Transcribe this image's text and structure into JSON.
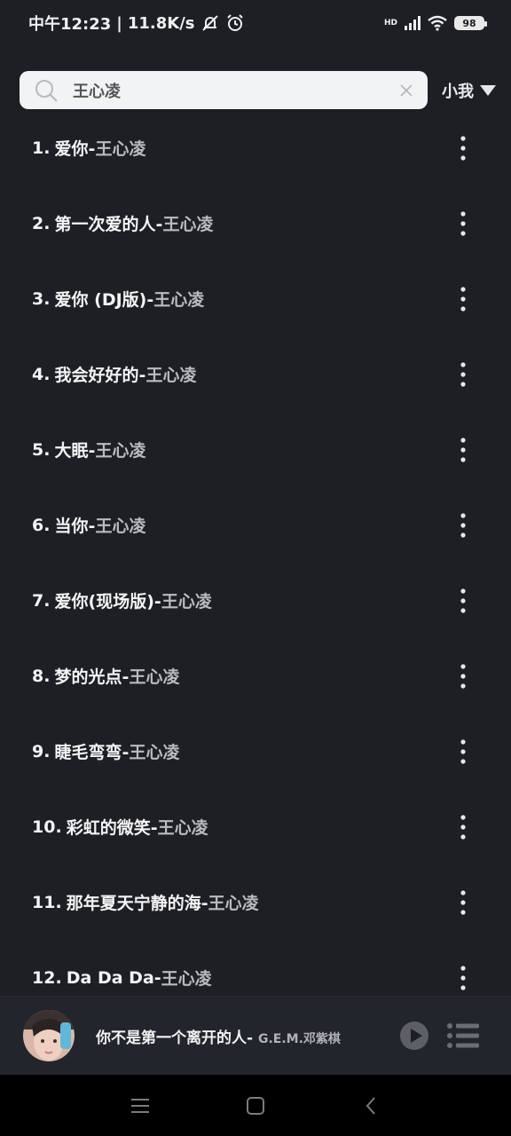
{
  "status": {
    "time": "中午12:23",
    "net_speed": "11.8K/s",
    "battery": "98",
    "hd_label": "HD"
  },
  "search": {
    "query": "王心凌",
    "user": "小我"
  },
  "songs": [
    {
      "num": "1.",
      "title": "爱你-",
      "artist": "王心凌"
    },
    {
      "num": "2.",
      "title": "第一次爱的人-",
      "artist": "王心凌"
    },
    {
      "num": "3.",
      "title": "爱你 (DJ版)-",
      "artist": "王心凌"
    },
    {
      "num": "4.",
      "title": "我会好好的-",
      "artist": "王心凌"
    },
    {
      "num": "5.",
      "title": "大眠-",
      "artist": "王心凌"
    },
    {
      "num": "6.",
      "title": "当你-",
      "artist": "王心凌"
    },
    {
      "num": "7.",
      "title": "爱你(现场版)-",
      "artist": "王心凌"
    },
    {
      "num": "8.",
      "title": "梦的光点-",
      "artist": "王心凌"
    },
    {
      "num": "9.",
      "title": "睫毛弯弯-",
      "artist": "王心凌"
    },
    {
      "num": "10.",
      "title": "彩虹的微笑-",
      "artist": "王心凌"
    },
    {
      "num": "11.",
      "title": "那年夏天宁静的海-",
      "artist": "王心凌"
    },
    {
      "num": "12.",
      "title": "Da Da Da-",
      "artist": "王心凌"
    }
  ],
  "player": {
    "title": "你不是第一个离开的人- ",
    "artist": "G.E.M.邓紫棋"
  },
  "icons": {
    "search": "search-icon",
    "clear": "close-icon",
    "dropdown": "triangle-down-icon",
    "more": "more-vertical-icon",
    "play": "play-icon",
    "playlist": "playlist-icon",
    "nav_menu": "menu-icon",
    "nav_home": "home-square-icon",
    "nav_back": "back-chevron-icon"
  }
}
